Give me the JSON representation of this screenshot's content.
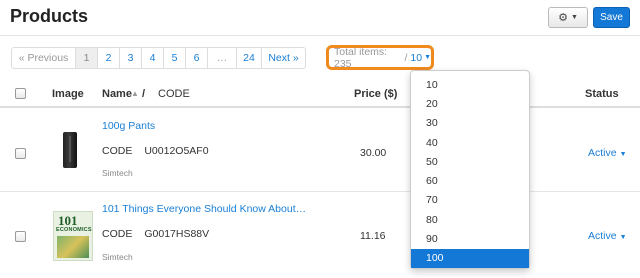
{
  "header": {
    "title": "Products",
    "save_label": "Save",
    "gear_icon": "gear-icon"
  },
  "pagination": {
    "prev_label": "« Previous",
    "pages": [
      "1",
      "2",
      "3",
      "4",
      "5",
      "6"
    ],
    "ellipsis": "…",
    "last_page": "24",
    "next_label": "Next »",
    "current_page": "1"
  },
  "items_per_page": {
    "total_label": "Total items: 235",
    "separator": "/",
    "current": "10"
  },
  "table": {
    "headers": {
      "image": "Image",
      "name": "Name",
      "slash": "/",
      "code": "CODE",
      "price": "Price ($)",
      "status": "Status"
    },
    "rows": [
      {
        "name": "100g Pants",
        "code_label": "CODE",
        "code": "U0012O5AF0",
        "vendor": "Simtech",
        "price": "30.00",
        "status": "Active"
      },
      {
        "name": "101 Things Everyone Should Know About…",
        "code_label": "CODE",
        "code": "G0017HS88V",
        "vendor": "Simtech",
        "price": "11.16",
        "status": "Active",
        "thumb_text": {
          "number": "101",
          "word": "ECONOMICS"
        }
      }
    ]
  },
  "dropdown": {
    "options": [
      "10",
      "20",
      "30",
      "40",
      "50",
      "60",
      "70",
      "80",
      "90",
      "100"
    ],
    "highlighted": "100"
  },
  "colors": {
    "accent": "#1478d6",
    "highlight_border": "#f08a1d",
    "link": "#1a7fd6"
  }
}
